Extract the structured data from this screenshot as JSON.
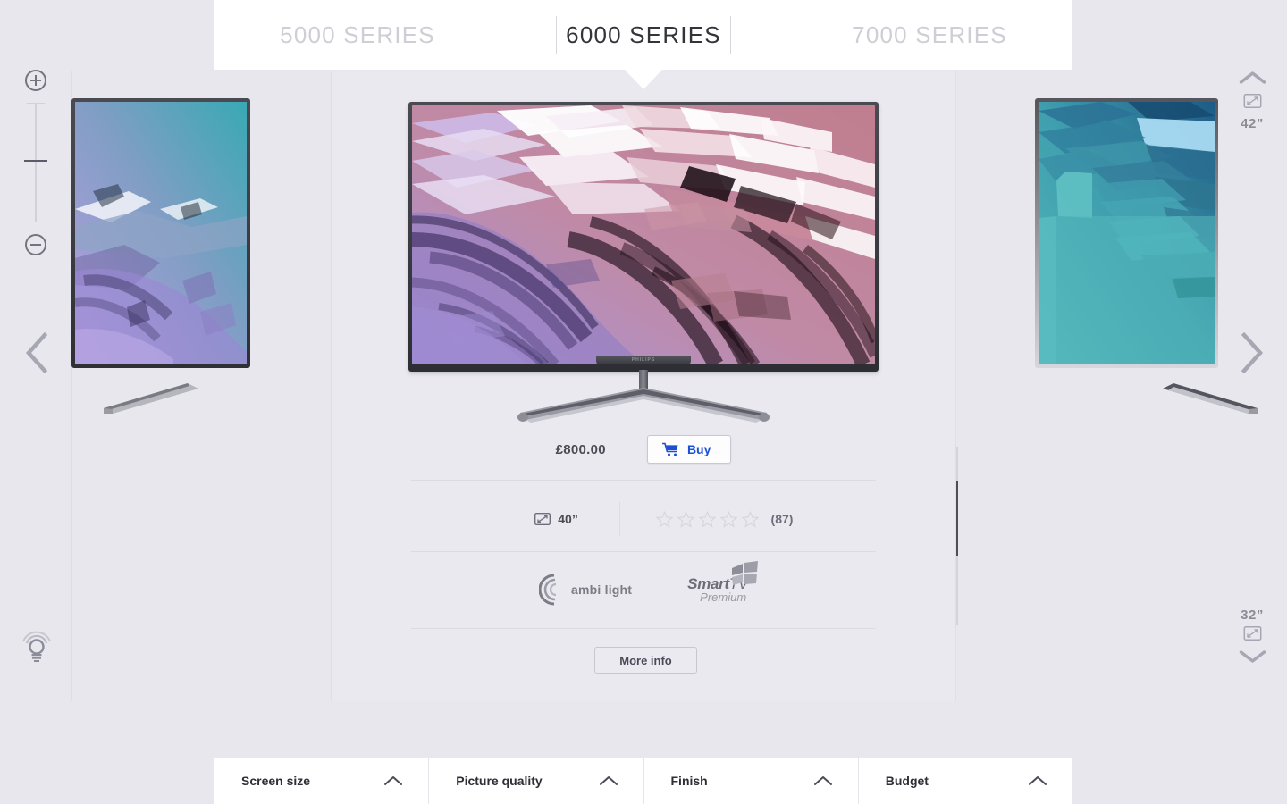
{
  "tabs": [
    {
      "label": "5000 SERIES",
      "active": false
    },
    {
      "label": "6000 SERIES",
      "active": true
    },
    {
      "label": "7000 SERIES",
      "active": false
    }
  ],
  "product": {
    "price": "£800.00",
    "buy_label": "Buy",
    "buy_icon": "shopping-cart-icon",
    "screen_size": "40”",
    "screen_size_icon": "screen-size-icon",
    "rating_stars": 0,
    "rating_star_total": 5,
    "review_count": "(87)",
    "more_info_label": "More info",
    "brand_badge": "PHILIPS",
    "features": [
      {
        "name": "ambilight",
        "text_a": "ambi",
        "text_b": "light",
        "icon": "ambilight-arcs-icon"
      },
      {
        "name": "smarttv-premium",
        "text_a": "Smart",
        "text_b": "TV",
        "text_c": "Premium",
        "icon": "windows-flag-icon"
      }
    ]
  },
  "left_rail": {
    "zoom_in_icon": "zoom-in-icon",
    "zoom_out_icon": "zoom-out-icon",
    "slider_name": "zoom-slider",
    "ambilight_toggle_icon": "lightbulb-icon",
    "prev_icon": "chevron-left-icon"
  },
  "right_rail": {
    "next_icon": "chevron-right-icon",
    "size_up_icon": "chevron-up-icon",
    "size_down_icon": "chevron-down-icon",
    "size_above": "42”",
    "size_below": "32”",
    "screen_icon": "screen-size-icon"
  },
  "filters": [
    {
      "label": "Screen size",
      "icon": "chevron-up-icon"
    },
    {
      "label": "Picture quality",
      "icon": "chevron-up-icon"
    },
    {
      "label": "Finish",
      "icon": "chevron-up-icon"
    },
    {
      "label": "Budget",
      "icon": "chevron-up-icon"
    }
  ],
  "colors": {
    "background": "#e8e7ed",
    "panel": "#eae9ef",
    "tab_active_text": "#33333a",
    "tab_inactive_text": "#cfced6",
    "buy_accent": "#1b4fd8",
    "text_dark": "#4b4b55",
    "muted": "#8c8c97"
  }
}
